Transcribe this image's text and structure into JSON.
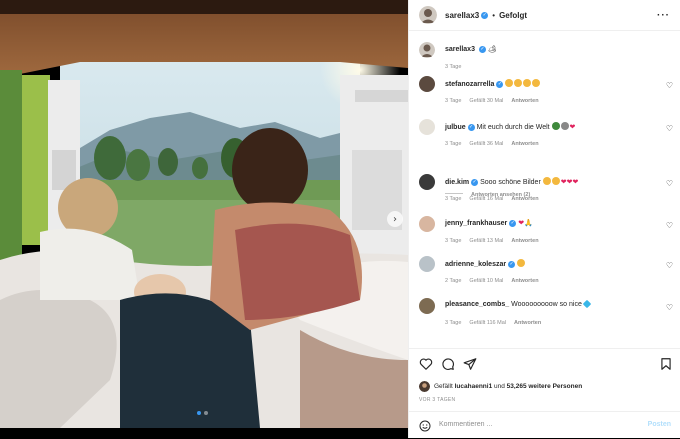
{
  "post": {
    "username": "sarellax3",
    "follow_status": "Gefolgt",
    "caption_emoji": "🏕",
    "caption_age": "3 Tage",
    "carousel": {
      "slide_count": 2,
      "active_slide": 1
    }
  },
  "comments": [
    {
      "user": "stefanozarrella",
      "text": "",
      "emojis": [
        "y",
        "y",
        "y",
        "y"
      ],
      "hearts": 0,
      "age": "3 Tage",
      "likes": "Gefällt 30 Mal",
      "reply": "Antworten",
      "avatar_color": "#5b4a3f",
      "verified": true
    },
    {
      "user": "julbue",
      "text": "Mit euch durch die Welt",
      "emojis": [
        "g",
        "k"
      ],
      "hearts": 1,
      "age": "3 Tage",
      "likes": "Gefällt 36 Mal",
      "reply": "Antworten",
      "avatar_color": "#e6e2da",
      "verified": true
    },
    {
      "user": "die.kim",
      "text": "Sooo schöne Bilder",
      "emojis": [
        "y",
        "y"
      ],
      "hearts": 3,
      "age": "3 Tage",
      "likes": "Gefällt 16 Mal",
      "reply": "Antworten",
      "avatar_color": "#3a3a3a",
      "verified": true
    },
    {
      "user": "jenny_frankhauser",
      "text": "",
      "emojis": [],
      "hearts": 1,
      "suffix": "🙏",
      "age": "3 Tage",
      "likes": "Gefällt 13 Mal",
      "reply": "Antworten",
      "avatar_color": "#d8b6a0",
      "verified": true
    },
    {
      "user": "adrienne_koleszar",
      "text": "",
      "emojis": [
        "y"
      ],
      "hearts": 0,
      "age": "2 Tage",
      "likes": "Gefällt 10 Mal",
      "reply": "Antworten",
      "avatar_color": "#b9c2c8",
      "verified": true
    },
    {
      "user": "pleasance_combs_",
      "text": "Wooooooooow so nice",
      "emojis": [
        "b"
      ],
      "hearts": 0,
      "age": "3 Tage",
      "likes": "Gefällt 116 Mal",
      "reply": "Antworten",
      "avatar_color": "#7d6b52",
      "verified": false
    }
  ],
  "view_replies": "Antworten ansehen (2)",
  "footer": {
    "likes_prefix": "Gefällt",
    "liked_by": "lucahaenni1",
    "likes_mid": "und",
    "others": "53,265 weitere Personen",
    "posted_ago": "VOR 3 TAGEN",
    "comment_placeholder": "Kommentieren ...",
    "post_label": "Posten"
  },
  "colors": {
    "accent": "#3897f0",
    "heart": "#e0245e",
    "muted": "#8e8e8e"
  },
  "icons": {
    "header_more": "more-horizontal-icon",
    "like": "heart-outline-icon",
    "comment": "comment-bubble-icon",
    "share": "paper-plane-icon",
    "save": "bookmark-icon",
    "emoji": "smiley-icon",
    "carousel_next": "chevron-right-icon"
  }
}
